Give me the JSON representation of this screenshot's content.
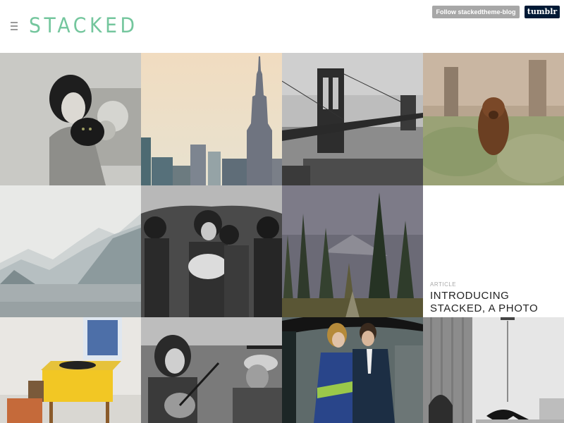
{
  "header": {
    "logo": "STACKED",
    "follow_label": "Follow stackedtheme-blog",
    "tumblr_label": "tumblr"
  },
  "colors": {
    "logo": "#74c69d",
    "follow_bg": "#a7a7a7",
    "tumblr_bg": "#001935"
  },
  "icons": {
    "menu": "hamburger-menu-icon"
  },
  "article": {
    "label": "ARTICLE",
    "title": "INTRODUCING STACKED, A PHOTO THEME FOR TUMBLR"
  }
}
